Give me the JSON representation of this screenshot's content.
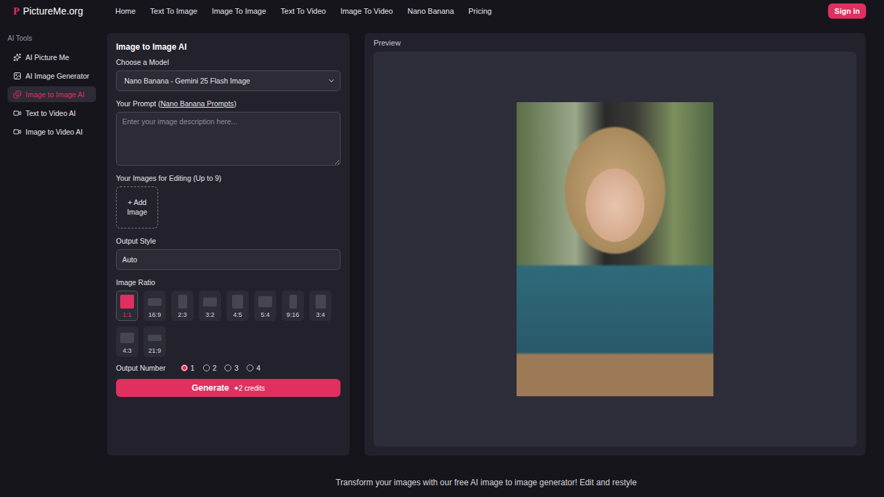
{
  "logo": {
    "mark": "P",
    "name": "PictureMe.org"
  },
  "nav": [
    "Home",
    "Text To Image",
    "Image To Image",
    "Text To Video",
    "Image To Video",
    "Nano Banana",
    "Pricing"
  ],
  "sign_in": "Sign in",
  "sidebar": {
    "heading": "AI Tools",
    "items": [
      {
        "label": "AI Picture Me",
        "selected": false
      },
      {
        "label": "AI Image Generator",
        "selected": false
      },
      {
        "label": "Image to Image AI",
        "selected": true
      },
      {
        "label": "Text to Video AI",
        "selected": false
      },
      {
        "label": "Image to Video AI",
        "selected": false
      }
    ]
  },
  "form": {
    "title": "Image to Image AI",
    "model_label": "Choose a Model",
    "model_value": "Nano Banana - Gemini 25 Flash Image",
    "prompt_label": "Your Prompt (",
    "prompt_link": "Nano Banana Prompts",
    "prompt_label_end": ")",
    "prompt_placeholder": "Enter your image description here...",
    "images_label": "Your Images for Editing (Up to 9)",
    "add_image": "+ Add Image",
    "style_label": "Output Style",
    "style_value": "Auto",
    "ratio_label": "Image Ratio",
    "ratios": [
      {
        "label": "1:1",
        "selected": true
      },
      {
        "label": "16:9",
        "selected": false
      },
      {
        "label": "2:3",
        "selected": false
      },
      {
        "label": "3:2",
        "selected": false
      },
      {
        "label": "4:5",
        "selected": false
      },
      {
        "label": "5:4",
        "selected": false
      },
      {
        "label": "9:16",
        "selected": false
      },
      {
        "label": "3:4",
        "selected": false
      },
      {
        "label": "4:3",
        "selected": false
      },
      {
        "label": "21:9",
        "selected": false
      }
    ],
    "output_label": "Output Number",
    "outputs": [
      {
        "label": "1",
        "selected": true
      },
      {
        "label": "2",
        "selected": false
      },
      {
        "label": "3",
        "selected": false
      },
      {
        "label": "4",
        "selected": false
      }
    ],
    "generate": "Generate",
    "credits_icon": "✦",
    "credits": "2 credits"
  },
  "preview": {
    "label": "Preview"
  },
  "footer_text": "Transform your images with our free AI image to image generator! Edit and restyle"
}
